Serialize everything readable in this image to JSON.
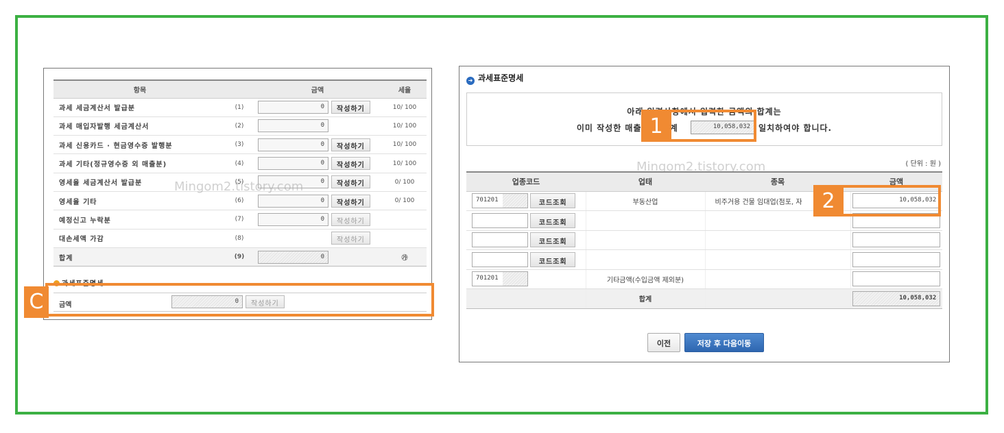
{
  "left": {
    "headers": {
      "item": "항목",
      "amount": "금액",
      "rate": "세율"
    },
    "rows": [
      {
        "item": "과세 세금계산서 발급분",
        "num": "(1)",
        "amount": "0",
        "button": "작성하기",
        "rate": "10/ 100"
      },
      {
        "item": "과세 매입자발행 세금계산서",
        "num": "(2)",
        "amount": "0",
        "button": "",
        "rate": "10/ 100"
      },
      {
        "item": "과세 신용카드 · 현금영수증 발행분",
        "num": "(3)",
        "amount": "0",
        "button": "작성하기",
        "rate": "10/ 100"
      },
      {
        "item": "과세 기타(정규영수증 외 매출분)",
        "num": "(4)",
        "amount": "0",
        "button": "작성하기",
        "rate": "10/ 100"
      },
      {
        "item": "영세율 세금계산서 발급분",
        "num": "(5)",
        "amount": "0",
        "button": "작성하기",
        "rate": "0/ 100"
      },
      {
        "item": "영세율 기타",
        "num": "(6)",
        "amount": "0",
        "button": "작성하기",
        "rate": "0/ 100"
      },
      {
        "item": "예정신고 누락분",
        "num": "(7)",
        "amount": "0",
        "button": "작성하기",
        "rate": ""
      },
      {
        "item": "대손세액 가감",
        "num": "(8)",
        "amount": "",
        "button": "작성하기",
        "rate": ""
      },
      {
        "item": "합계",
        "num": "(9)",
        "amount": "0",
        "button": "",
        "rate": "㉮"
      }
    ],
    "sub_title": "과세표준명세",
    "amount_label": "금액",
    "amount_value": "0",
    "amount_button": "작성하기",
    "callout": "C"
  },
  "right": {
    "title": "과세표준명세",
    "notice_line1": "아래 입력사항에서 입력한 금액의 합계는",
    "notice_line2_pre": "이미 작성한 매출금액 합계",
    "notice_total": "10,058,032",
    "notice_line2_post": "와 일치하여야 합니다.",
    "unit": "( 단위 : 원 )",
    "headers": {
      "code": "업종코드",
      "business": "업태",
      "item": "종목",
      "amount": "금액"
    },
    "rows": [
      {
        "code": "701201",
        "button": "코드조회",
        "business": "부동산업",
        "item": "비주거용 건물 임대업(점포, 자",
        "amount": "10,058,032"
      },
      {
        "code": "",
        "button": "코드조회",
        "business": "",
        "item": "",
        "amount": ""
      },
      {
        "code": "",
        "button": "코드조회",
        "business": "",
        "item": "",
        "amount": ""
      },
      {
        "code": "",
        "button": "코드조회",
        "business": "",
        "item": "",
        "amount": ""
      },
      {
        "code": "701201",
        "button": "",
        "business": "기타금액(수입금액 제외분)",
        "item": "",
        "amount": ""
      }
    ],
    "total_label": "합계",
    "total_amount": "10,058,032",
    "btn_prev": "이전",
    "btn_next": "저장 후 다음이동",
    "callout1": "1",
    "callout2": "2"
  },
  "watermark": "Mingom2.tistory.com",
  "colors": {
    "frame": "#3cb043",
    "callout": "#f08a32",
    "primary_button": "#2e66b0"
  }
}
